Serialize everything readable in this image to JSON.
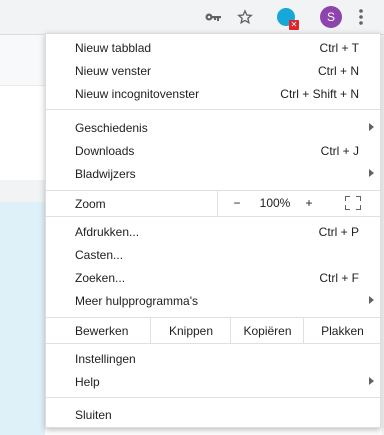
{
  "toolbar": {
    "icons": [
      "key-icon",
      "star-icon",
      "extension-icon",
      "kebab-menu-icon"
    ],
    "avatar_letter": "S",
    "avatar_color": "#8e44ad"
  },
  "menu": {
    "group1": [
      {
        "label": "Nieuw tabblad",
        "shortcut": "Ctrl + T"
      },
      {
        "label": "Nieuw venster",
        "shortcut": "Ctrl + N"
      },
      {
        "label": "Nieuw incognitovenster",
        "shortcut": "Ctrl + Shift + N"
      }
    ],
    "group2": [
      {
        "label": "Geschiedenis",
        "shortcut": ""
      },
      {
        "label": "Downloads",
        "shortcut": "Ctrl + J"
      },
      {
        "label": "Bladwijzers",
        "shortcut": ""
      }
    ],
    "zoom": {
      "label": "Zoom",
      "minus": "−",
      "value": "100%",
      "plus": "+"
    },
    "group3": [
      {
        "label": "Afdrukken...",
        "shortcut": "Ctrl + P"
      },
      {
        "label": "Casten...",
        "shortcut": ""
      },
      {
        "label": "Zoeken...",
        "shortcut": "Ctrl + F"
      },
      {
        "label": "Meer hulpprogramma's",
        "shortcut": ""
      }
    ],
    "edit": {
      "label": "Bewerken",
      "cut": "Knippen",
      "copy": "Kopiëren",
      "paste": "Plakken"
    },
    "group4": [
      {
        "label": "Instellingen"
      },
      {
        "label": "Help"
      }
    ],
    "exit": {
      "label": "Sluiten"
    }
  }
}
